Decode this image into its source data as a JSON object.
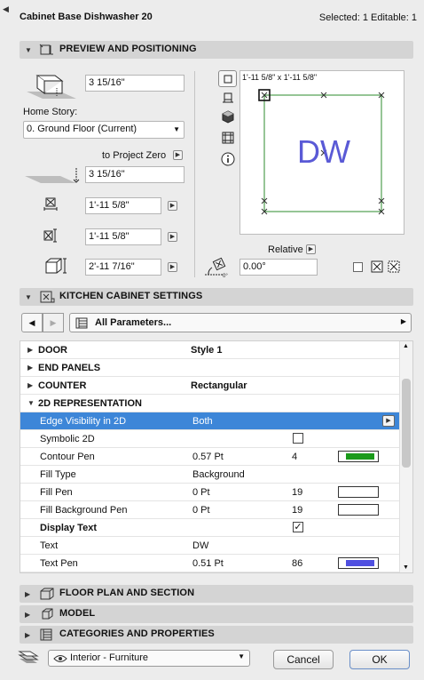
{
  "window": {
    "title": "Cabinet Base Dishwasher 20",
    "status": "Selected: 1 Editable: 1"
  },
  "preview": {
    "header": "PREVIEW AND POSITIONING",
    "height_value": "3 15/16\"",
    "home_story_label": "Home Story:",
    "home_story_value": "0. Ground Floor (Current)",
    "to_project_zero_label": "to Project Zero",
    "project_zero_value": "3 15/16\"",
    "width_value": "1'-11 5/8\"",
    "depth_value": "1'-11 5/8\"",
    "size_value": "2'-11 7/16\"",
    "canvas_size": "1'-11 5/8\" x 1'-11 5/8\"",
    "canvas_text": "DW",
    "relative_label": "Relative",
    "angle_value": "0.00°"
  },
  "kitchen": {
    "header": "KITCHEN CABINET SETTINGS",
    "dropdown": "All Parameters...",
    "params": [
      {
        "name": "DOOR",
        "value": "Style 1",
        "group": true,
        "open": false
      },
      {
        "name": "END PANELS",
        "value": "",
        "group": true,
        "open": false
      },
      {
        "name": "COUNTER",
        "value": "Rectangular",
        "group": true,
        "open": false
      },
      {
        "name": "2D REPRESENTATION",
        "value": "",
        "group": true,
        "open": true
      },
      {
        "name": "Edge Visibility in 2D",
        "value": "Both",
        "selected": true
      },
      {
        "name": "Symbolic 2D",
        "value": "",
        "checkbox": false
      },
      {
        "name": "Contour Pen",
        "value": "0.57 Pt",
        "num": "4",
        "pen_color": "#1a9a1a"
      },
      {
        "name": "Fill Type",
        "value": "Background"
      },
      {
        "name": "Fill Pen",
        "value": "0 Pt",
        "num": "19",
        "pen_color": "#ffffff"
      },
      {
        "name": "Fill Background Pen",
        "value": "0 Pt",
        "num": "19",
        "pen_color": "#ffffff"
      },
      {
        "name": "Display Text",
        "value": "",
        "checkbox": true,
        "bold": true
      },
      {
        "name": "Text",
        "value": "DW"
      },
      {
        "name": "Text Pen",
        "value": "0.51 Pt",
        "num": "86",
        "pen_color": "#5050e0"
      }
    ]
  },
  "sections": {
    "floor_plan": "FLOOR PLAN AND SECTION",
    "model": "MODEL",
    "categories": "CATEGORIES AND PROPERTIES"
  },
  "footer": {
    "layer": "Interior - Furniture",
    "cancel": "Cancel",
    "ok": "OK"
  },
  "colors": {
    "selection": "#3d86d8",
    "plan_line": "#2e8b2e",
    "plan_text": "#5a5ad6"
  }
}
